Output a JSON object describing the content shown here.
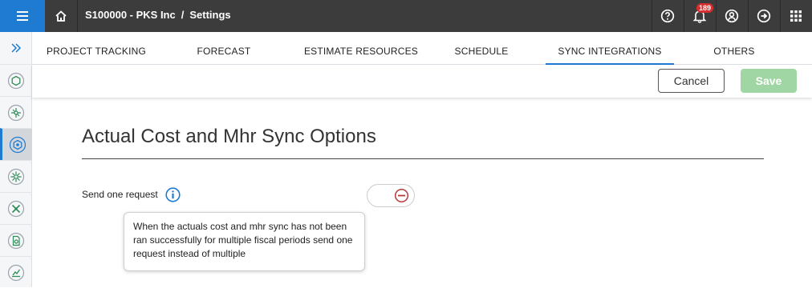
{
  "header": {
    "company": "S100000 - PKS Inc",
    "separator": "/",
    "page": "Settings",
    "notification_count": "189",
    "icons": [
      "menu-icon",
      "home-icon",
      "help-icon",
      "bell-icon",
      "user-icon",
      "logout-icon",
      "apps-grid-icon"
    ]
  },
  "sidebar": {
    "icons": [
      "expand-icon",
      "hexagon-icon",
      "network-icon",
      "target-icon",
      "settings-gear-icon",
      "tools-icon",
      "document-badge-icon",
      "chart-icon"
    ],
    "active_index": 2
  },
  "tabs": [
    {
      "label": "PROJECT TRACKING"
    },
    {
      "label": "FORECAST"
    },
    {
      "label": "ESTIMATE RESOURCES"
    },
    {
      "label": "SCHEDULE"
    },
    {
      "label": "SYNC INTEGRATIONS"
    },
    {
      "label": "OTHERS"
    }
  ],
  "active_tab": "SYNC INTEGRATIONS",
  "actions": {
    "cancel_label": "Cancel",
    "save_label": "Save"
  },
  "content": {
    "section_title": "Actual Cost and Mhr Sync Options",
    "field_label": "Send one request",
    "toggle_state": "off",
    "tooltip_text": "When the actuals cost and mhr sync has not been ran successfully for multiple fiscal periods send one request instead of multiple"
  },
  "colors": {
    "topbar": "#3c3c3c",
    "accent": "#1f7bd1",
    "save_disabled": "#9fd6a4",
    "badge": "#d32f2f",
    "toggle_off": "#b33a3a",
    "rail_icon": "#2e8b57"
  }
}
